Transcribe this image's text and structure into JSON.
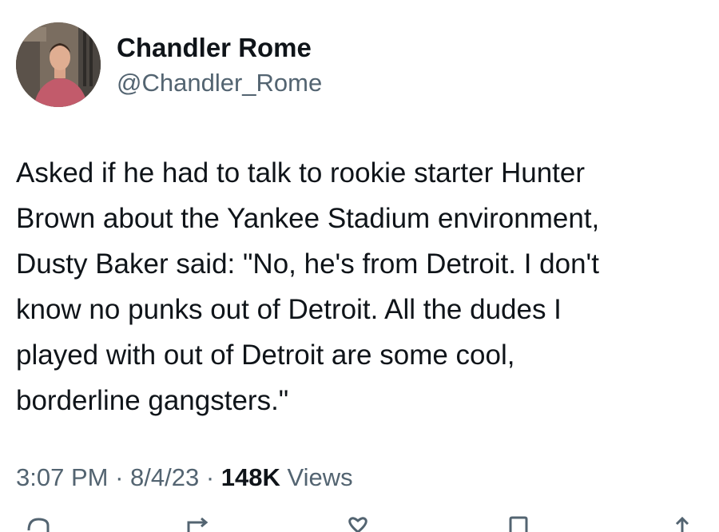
{
  "author": {
    "display_name": "Chandler Rome",
    "handle": "@Chandler_Rome"
  },
  "tweet": {
    "text": "Asked if he had to talk to rookie starter Hunter\nBrown about the Yankee Stadium environment,\nDusty Baker said: \"No, he's from Detroit. I don't\nknow no punks out of Detroit. All the dudes I\nplayed with out of Detroit are some cool,\nborderline gangsters.\""
  },
  "meta": {
    "time": "3:07 PM",
    "separator": " · ",
    "date": "8/4/23",
    "views_count": "148K",
    "views_label": " Views"
  },
  "icons": [
    "reply-icon",
    "retweet-icon",
    "like-icon",
    "bookmark-icon",
    "share-icon"
  ],
  "colors": {
    "text_primary": "#0f1419",
    "text_secondary": "#536471",
    "background": "#ffffff"
  }
}
